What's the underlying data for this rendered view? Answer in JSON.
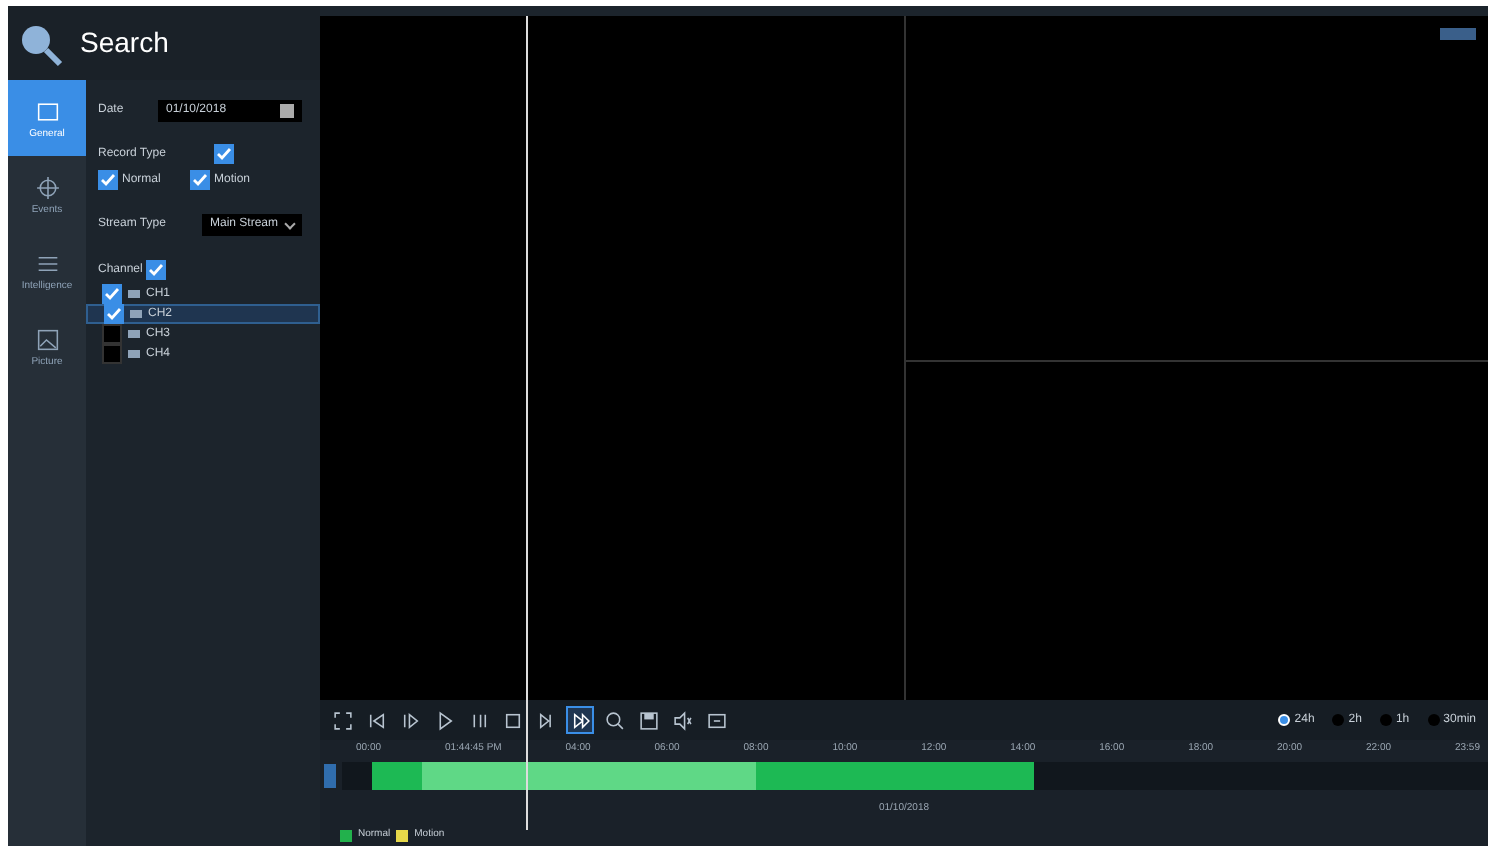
{
  "header": {
    "title": "Search"
  },
  "nav": [
    {
      "label": "General",
      "kind": "folder",
      "selected": true
    },
    {
      "label": "Events",
      "kind": "target",
      "selected": false
    },
    {
      "label": "Intelligence",
      "kind": "list",
      "selected": false
    },
    {
      "label": "Picture",
      "kind": "image",
      "selected": false
    }
  ],
  "filters": {
    "date_label": "Date",
    "date_value": "01/10/2018",
    "record_type_label": "Record Type",
    "record_type_checked": true,
    "record_types": [
      {
        "label": "Normal",
        "checked": true
      },
      {
        "label": "Motion",
        "checked": true
      }
    ],
    "stream_type_label": "Stream Type",
    "stream_type_value": "Main Stream",
    "channel_label": "Channel",
    "channel_checked": true
  },
  "channels": [
    {
      "label": "CH1",
      "checked": true,
      "selected": false
    },
    {
      "label": "CH2",
      "checked": true,
      "selected": true
    },
    {
      "label": "CH3",
      "checked": false,
      "selected": false
    },
    {
      "label": "CH4",
      "checked": false,
      "selected": false
    }
  ],
  "toolbar": [
    {
      "kind": "fullscreen",
      "selected": false
    },
    {
      "kind": "rewind",
      "selected": false
    },
    {
      "kind": "reverse",
      "selected": false
    },
    {
      "kind": "play",
      "selected": false
    },
    {
      "kind": "pause",
      "selected": false
    },
    {
      "kind": "stop",
      "selected": false
    },
    {
      "kind": "forward",
      "selected": false
    },
    {
      "kind": "step",
      "selected": true
    },
    {
      "kind": "zoom",
      "selected": false
    },
    {
      "kind": "save",
      "selected": false
    },
    {
      "kind": "audio",
      "selected": false
    },
    {
      "kind": "clip",
      "selected": false
    }
  ],
  "scales": [
    {
      "label": "24h",
      "selected": true
    },
    {
      "label": "2h",
      "selected": false
    },
    {
      "label": "1h",
      "selected": false
    },
    {
      "label": "30min",
      "selected": false
    }
  ],
  "ticks": [
    "00:00",
    "01:44:45 PM",
    "04:00",
    "06:00",
    "08:00",
    "10:00",
    "12:00",
    "14:00",
    "16:00",
    "18:00",
    "20:00",
    "22:00",
    "23:59"
  ],
  "date_caption": "01/10/2018",
  "legend": [
    {
      "label": "Normal",
      "color": "#22b14c"
    },
    {
      "label": "Motion",
      "color": "#e6d84a"
    }
  ]
}
